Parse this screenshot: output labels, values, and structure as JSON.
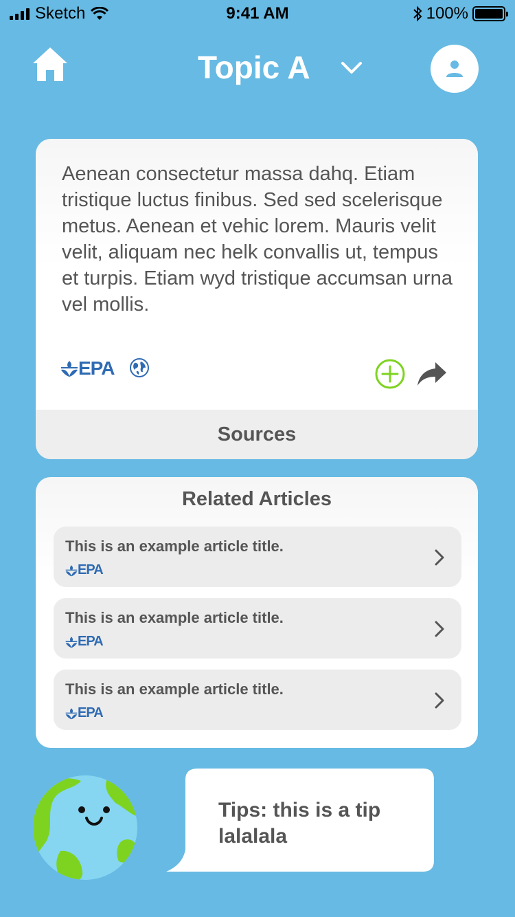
{
  "status_bar": {
    "carrier": "Sketch",
    "time": "9:41 AM",
    "battery": "100%"
  },
  "nav": {
    "title": "Topic A"
  },
  "main_card": {
    "body": "Aenean consectetur massa dahq. Etiam tristique luctus finibus. Sed sed scelerisque metus. Aenean et vehic lorem. Mauris velit velit, aliquam nec helk convallis ut, tempus et turpis. Etiam wyd tristique accumsan urna vel mollis.",
    "source_logo": "EPA",
    "sources_label": "Sources"
  },
  "related": {
    "title": "Related Articles",
    "articles": [
      {
        "title": "This is an example article title.",
        "source": "EPA"
      },
      {
        "title": "This is an example article title.",
        "source": "EPA"
      },
      {
        "title": "This is an example article title.",
        "source": "EPA"
      }
    ]
  },
  "tip": {
    "text": "Tips: this is a tip lalalala"
  },
  "colors": {
    "background": "#67bae3",
    "card": "#ffffff",
    "text": "#555555",
    "epa_blue": "#2f6bb3",
    "add_green": "#7ed321"
  },
  "icons": {
    "home": "home-icon",
    "dropdown": "chevron-down-icon",
    "profile": "user-icon",
    "globe": "globe-icon",
    "add": "plus-circle-icon",
    "share": "share-arrow-icon",
    "article_arrow": "chevron-right-icon",
    "mascot": "earth-mascot"
  }
}
